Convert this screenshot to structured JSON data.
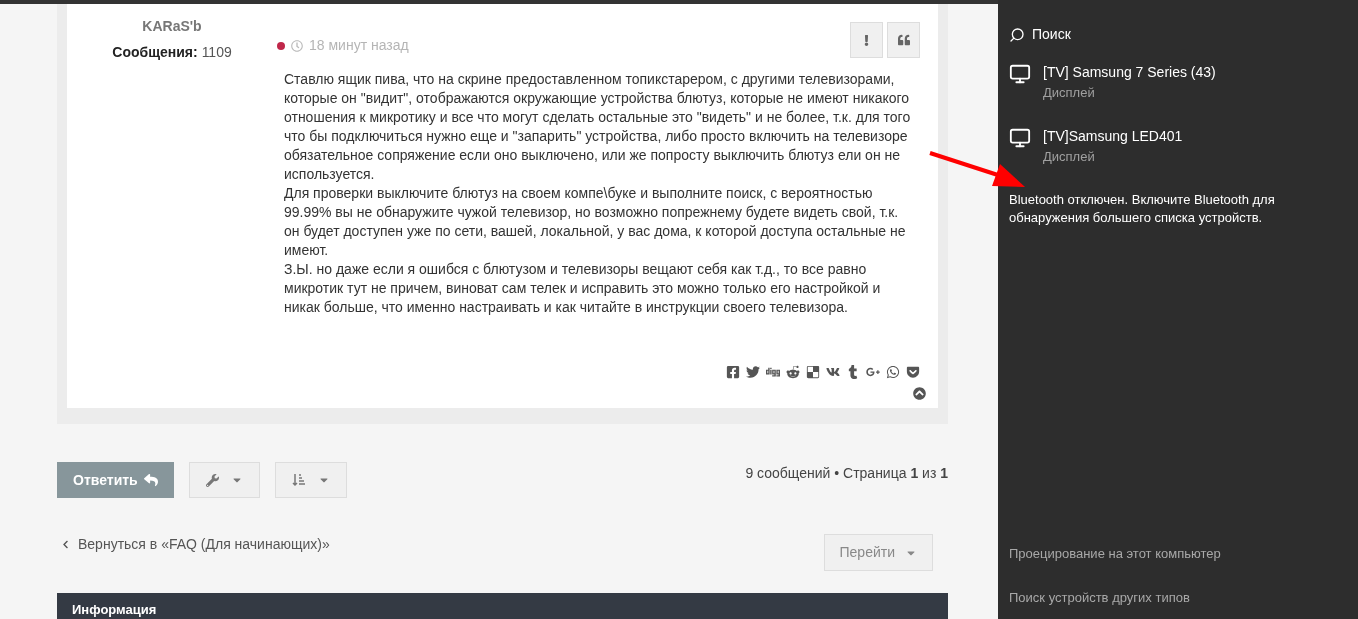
{
  "post": {
    "author": "KARaS'b",
    "posts_label": "Сообщения:",
    "posts_count": "1109",
    "time": "18 минут назад",
    "paragraphs": [
      "Ставлю ящик пива, что на скрине предоставленном топикстарером, с другими телевизорами, которые он \"видит\", отображаются окружающие устройства блютуз, которые не имеют никакого отношения к микротику и все что могут сделать остальные это \"видеть\" и не более, т.к. для того что бы подключиться нужно еще и \"запарить\" устройства, либо просто включить на телевизоре обязательное сопряжение если оно выключено, или же попросту выключить блютуз ели он не используется.",
      "Для проверки выключите блютуз на своем компе\\буке и выполните поиск, с вероятностью 99.99% вы не обнаружите чужой телевизор, но возможно попрежнему будете видеть свой, т.к. он будет доступен уже по сети, вашей, локальной, у вас дома, к которой доступа остальные не имеют.",
      "З.Ы. но даже если я ошибся с блютузом и телевизоры вещают себя как т.д., то все равно микротик тут не причем, виноват сам телек и исправить это можно только его настройкой и никак больше, что именно настраивать и как читайте в инструкции своего телевизора."
    ]
  },
  "actions": {
    "reply": "Ответить",
    "pagination": "9 сообщений • Страница **1** из **1**",
    "back_link": "Вернуться в «FAQ (Для начинающих)»",
    "jump": "Перейти"
  },
  "info_bar": {
    "title": "Информация"
  },
  "connect_panel": {
    "search": "Поиск",
    "devices": [
      {
        "name": "[TV] Samsung 7 Series (43)",
        "type": "Дисплей"
      },
      {
        "name": "[TV]Samsung LED401",
        "type": "Дисплей"
      }
    ],
    "message": "Bluetooth отключен. Включите Bluetooth для обнаружения большего списка устройств.",
    "links": [
      "Проецирование на этот компьютер",
      "Поиск устройств других типов"
    ]
  }
}
